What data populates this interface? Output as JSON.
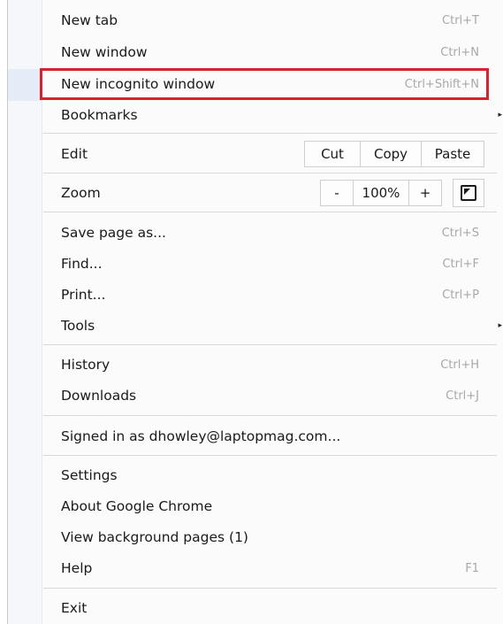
{
  "menu": {
    "items": {
      "new_tab": {
        "label": "New tab",
        "shortcut": "Ctrl+T"
      },
      "new_window": {
        "label": "New window",
        "shortcut": "Ctrl+N"
      },
      "new_incognito": {
        "label": "New incognito window",
        "shortcut": "Ctrl+Shift+N"
      },
      "bookmarks": {
        "label": "Bookmarks",
        "arrow": "▸"
      },
      "edit": {
        "label": "Edit",
        "cut": "Cut",
        "copy": "Copy",
        "paste": "Paste"
      },
      "zoom": {
        "label": "Zoom",
        "minus": "-",
        "level": "100%",
        "plus": "+",
        "fullscreen_icon": "fullscreen-icon"
      },
      "save_page": {
        "label": "Save page as...",
        "shortcut": "Ctrl+S"
      },
      "find": {
        "label": "Find...",
        "shortcut": "Ctrl+F"
      },
      "print": {
        "label": "Print...",
        "shortcut": "Ctrl+P"
      },
      "tools": {
        "label": "Tools",
        "arrow": "▸"
      },
      "history": {
        "label": "History",
        "shortcut": "Ctrl+H"
      },
      "downloads": {
        "label": "Downloads",
        "shortcut": "Ctrl+J"
      },
      "signed_in": {
        "label": "Signed in as dhowley@laptopmag.com..."
      },
      "settings": {
        "label": "Settings"
      },
      "about": {
        "label": "About Google Chrome"
      },
      "background_pages": {
        "label": "View background pages (1)"
      },
      "help": {
        "label": "Help",
        "shortcut": "F1"
      },
      "exit": {
        "label": "Exit"
      }
    },
    "colors": {
      "highlight_border": "#d8202e",
      "shortcut_text": "#a8a8a8"
    }
  }
}
